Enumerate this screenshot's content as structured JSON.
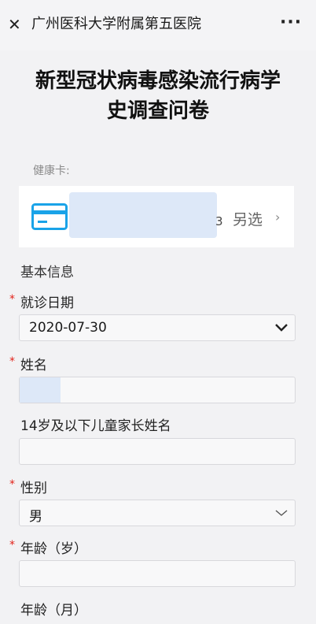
{
  "header": {
    "close_glyph": "✕",
    "title": "广州医科大学附属第五医院",
    "more_glyph": "···"
  },
  "page": {
    "title_line1": "新型冠状病毒感染流行病学",
    "title_line2": "史调查问卷"
  },
  "health_card": {
    "label": "健康卡:",
    "number_tail": "3",
    "switch_label": "另选",
    "chevron": "›",
    "icon": "card-icon"
  },
  "basic_info": {
    "section_title": "基本信息"
  },
  "form": {
    "visit_date": {
      "label": "就诊日期",
      "required": "*",
      "value": "2020-07-30"
    },
    "name": {
      "label": "姓名",
      "required": "*",
      "value": ""
    },
    "guardian_name": {
      "label": "14岁及以下儿童家长姓名",
      "value": ""
    },
    "gender": {
      "label": "性别",
      "required": "*",
      "value": "男"
    },
    "age_years": {
      "label": "年龄（岁）",
      "required": "*",
      "value": ""
    },
    "age_months": {
      "label": "年龄（月）"
    }
  },
  "colors": {
    "required": "#e2231a",
    "card_icon": "#1aa3e8",
    "mask": "#dde8f8"
  }
}
